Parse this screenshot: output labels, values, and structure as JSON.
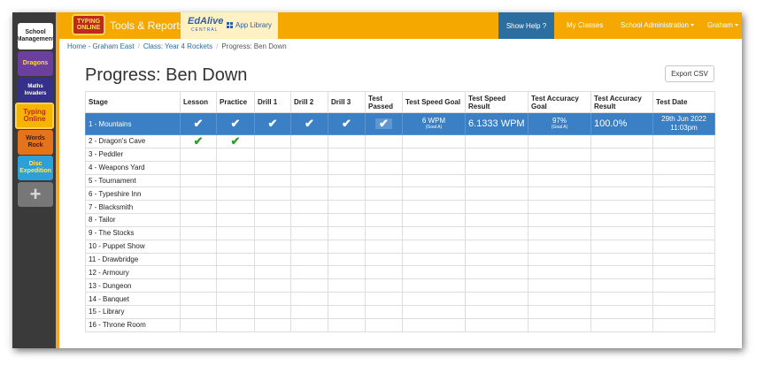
{
  "leftbar": {
    "tiles": [
      {
        "label": "School Management"
      },
      {
        "label": "Dragons"
      },
      {
        "label": "Maths Invaders"
      },
      {
        "label": "Typing Online"
      },
      {
        "label": "Words Rock"
      },
      {
        "label": "Disc Expedition"
      },
      {
        "label": "+"
      }
    ]
  },
  "topbar": {
    "logo_text": "TYPING ONLINE",
    "title": "Tools & Reports",
    "edalive_logo": "EdAlive",
    "edalive_sub": "CENTRAL",
    "app_library": "App Library",
    "show_help": "Show Help ?",
    "my_classes": "My Classes",
    "school_admin": "School Administration",
    "user": "Graham"
  },
  "breadcrumb": {
    "home": "Home - Graham East",
    "class": "Class: Year 4 Rockets",
    "current": "Progress: Ben Down"
  },
  "page": {
    "title": "Progress: Ben Down",
    "export_label": "Export CSV"
  },
  "table": {
    "headers": [
      "Stage",
      "Lesson",
      "Practice",
      "Drill 1",
      "Drill 2",
      "Drill 3",
      "Test Passed",
      "Test Speed Goal",
      "Test Speed Result",
      "Test Accuracy Goal",
      "Test Accuracy Result",
      "Test Date"
    ],
    "active_row": {
      "stage": "1 - Mountains",
      "speed_goal": "6 WPM",
      "speed_goal_sub": "(Goal A)",
      "speed_result": "6.1333 WPM",
      "accuracy_goal": "97%",
      "accuracy_goal_sub": "(Goal A)",
      "accuracy_result": "100.0%",
      "date": "29th Jun 2022",
      "time": "11:03pm"
    },
    "check_glyph": "✔",
    "rows": [
      "2 - Dragon's Cave",
      "3 - Peddler",
      "4 - Weapons Yard",
      "5 - Tournament",
      "6 - Typeshire Inn",
      "7 - Blacksmith",
      "8 - Tailor",
      "9 - The Stocks",
      "10 - Puppet Show",
      "11 - Drawbridge",
      "12 - Armoury",
      "13 - Dungeon",
      "14 - Banquet",
      "15 - Library",
      "16 - Throne Room"
    ]
  }
}
